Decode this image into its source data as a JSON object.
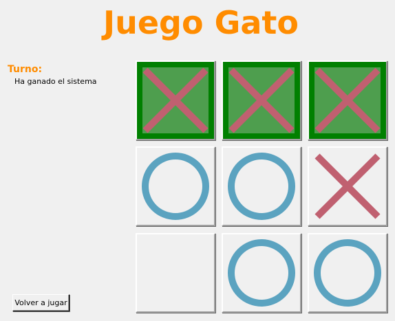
{
  "title": "Juego Gato",
  "turn_label": "Turno:",
  "status_message": "Ha ganado el sistema",
  "replay_button": "Volver a jugar",
  "colors": {
    "title": "#ff8c00",
    "win_cell": "#008000",
    "x_mark": "#c06070",
    "o_mark": "#5ba3c0",
    "background": "#f0f0f0"
  },
  "board": {
    "cells": [
      [
        "X",
        "X",
        "X"
      ],
      [
        "O",
        "O",
        "X"
      ],
      [
        "",
        "O",
        "O"
      ]
    ],
    "winning_row": 0
  }
}
